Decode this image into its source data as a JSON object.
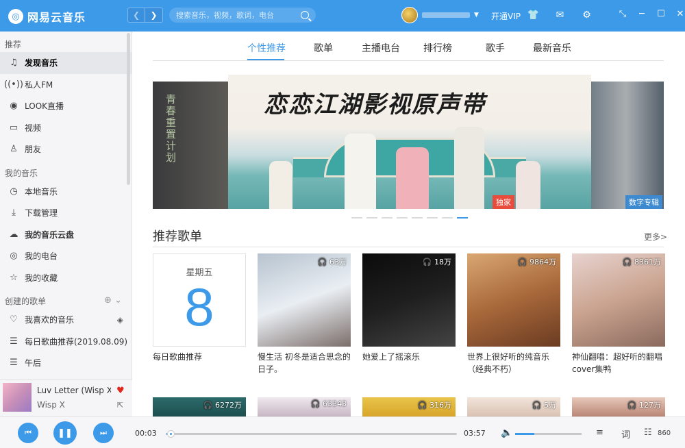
{
  "app": {
    "name": "网易云音乐"
  },
  "search": {
    "placeholder": "搜索音乐，视频，歌词，电台"
  },
  "header": {
    "vip_label": "开通VIP",
    "back_icon": "chevron-left-icon",
    "forward_icon": "chevron-right-icon"
  },
  "sidebar": {
    "section_recommend": "推荐",
    "recommend_items": [
      {
        "label": "发现音乐",
        "icon": "music-note-icon"
      },
      {
        "label": "私人FM",
        "icon": "radio-icon"
      },
      {
        "label": "LOOK直播",
        "icon": "live-icon"
      },
      {
        "label": "视频",
        "icon": "video-icon"
      },
      {
        "label": "朋友",
        "icon": "friends-icon"
      }
    ],
    "section_my_music": "我的音乐",
    "my_music_items": [
      {
        "label": "本地音乐",
        "icon": "clock-icon"
      },
      {
        "label": "下载管理",
        "icon": "download-icon"
      },
      {
        "label": "我的音乐云盘",
        "icon": "cloud-icon"
      },
      {
        "label": "我的电台",
        "icon": "podcast-icon"
      },
      {
        "label": "我的收藏",
        "icon": "collection-icon"
      }
    ],
    "section_created": "创建的歌单",
    "created_items": [
      {
        "label": "我喜欢的音乐",
        "icon": "heart-icon"
      },
      {
        "label": "每日歌曲推荐(2019.08.09)",
        "icon": "playlist-icon"
      },
      {
        "label": "午后",
        "icon": "playlist-icon"
      }
    ]
  },
  "now_playing": {
    "title": "Luv Letter (Wisp X...",
    "artist": "Wisp X"
  },
  "tabs": [
    {
      "label": "个性推荐"
    },
    {
      "label": "歌单"
    },
    {
      "label": "主播电台"
    },
    {
      "label": "排行榜"
    },
    {
      "label": "歌手"
    },
    {
      "label": "最新音乐"
    }
  ],
  "banner": {
    "title": "恋恋江湖影视原声带",
    "left_text": "青春重置计划",
    "badge_exclusive": "独家",
    "badge_digital": "数字专辑",
    "dot_count": 8,
    "active_dot": 7
  },
  "section": {
    "title": "推荐歌单",
    "more": "更多>"
  },
  "daily": {
    "weekday": "星期五",
    "day": "8",
    "title": "每日歌曲推荐"
  },
  "playlists": [
    {
      "plays": "63万",
      "title": "慢生活 初冬是适合思念的日子。",
      "colors": [
        "#b7c3cf",
        "#e9eef3",
        "#7b6e6a"
      ]
    },
    {
      "plays": "18万",
      "title": "她爱上了摇滚乐",
      "colors": [
        "#0b0b0b",
        "#1f1f1f",
        "#444444"
      ]
    },
    {
      "plays": "9864万",
      "title": "世界上很好听的纯音乐（经典不朽）",
      "colors": [
        "#d9a772",
        "#a8683a",
        "#6a3b22"
      ]
    },
    {
      "plays": "8361万",
      "title": "神仙翻唱：超好听的翻唱cover集鸭",
      "colors": [
        "#e7d3cf",
        "#caa38f",
        "#8a6a5e"
      ]
    }
  ],
  "row2": [
    {
      "plays": "6272万",
      "colors": [
        "#2c6b6a",
        "#1d4f4f"
      ]
    },
    {
      "plays": "63343",
      "colors": [
        "#efe9ee",
        "#c7b6c4"
      ]
    },
    {
      "plays": "316万",
      "colors": [
        "#e9c44a",
        "#d8a52b"
      ]
    },
    {
      "plays": "5万",
      "colors": [
        "#f2e4da",
        "#d9c2b3"
      ]
    },
    {
      "plays": "127万",
      "colors": [
        "#e7c7b9",
        "#b98676"
      ]
    }
  ],
  "player": {
    "current_time": "00:03",
    "total_time": "03:57",
    "progress_fraction": 0.013,
    "volume_fraction": 0.29,
    "lyrics_label": "词",
    "playlist_count": "860"
  },
  "colors": {
    "accent": "#3d9ae8",
    "heart": "#e0271c"
  }
}
